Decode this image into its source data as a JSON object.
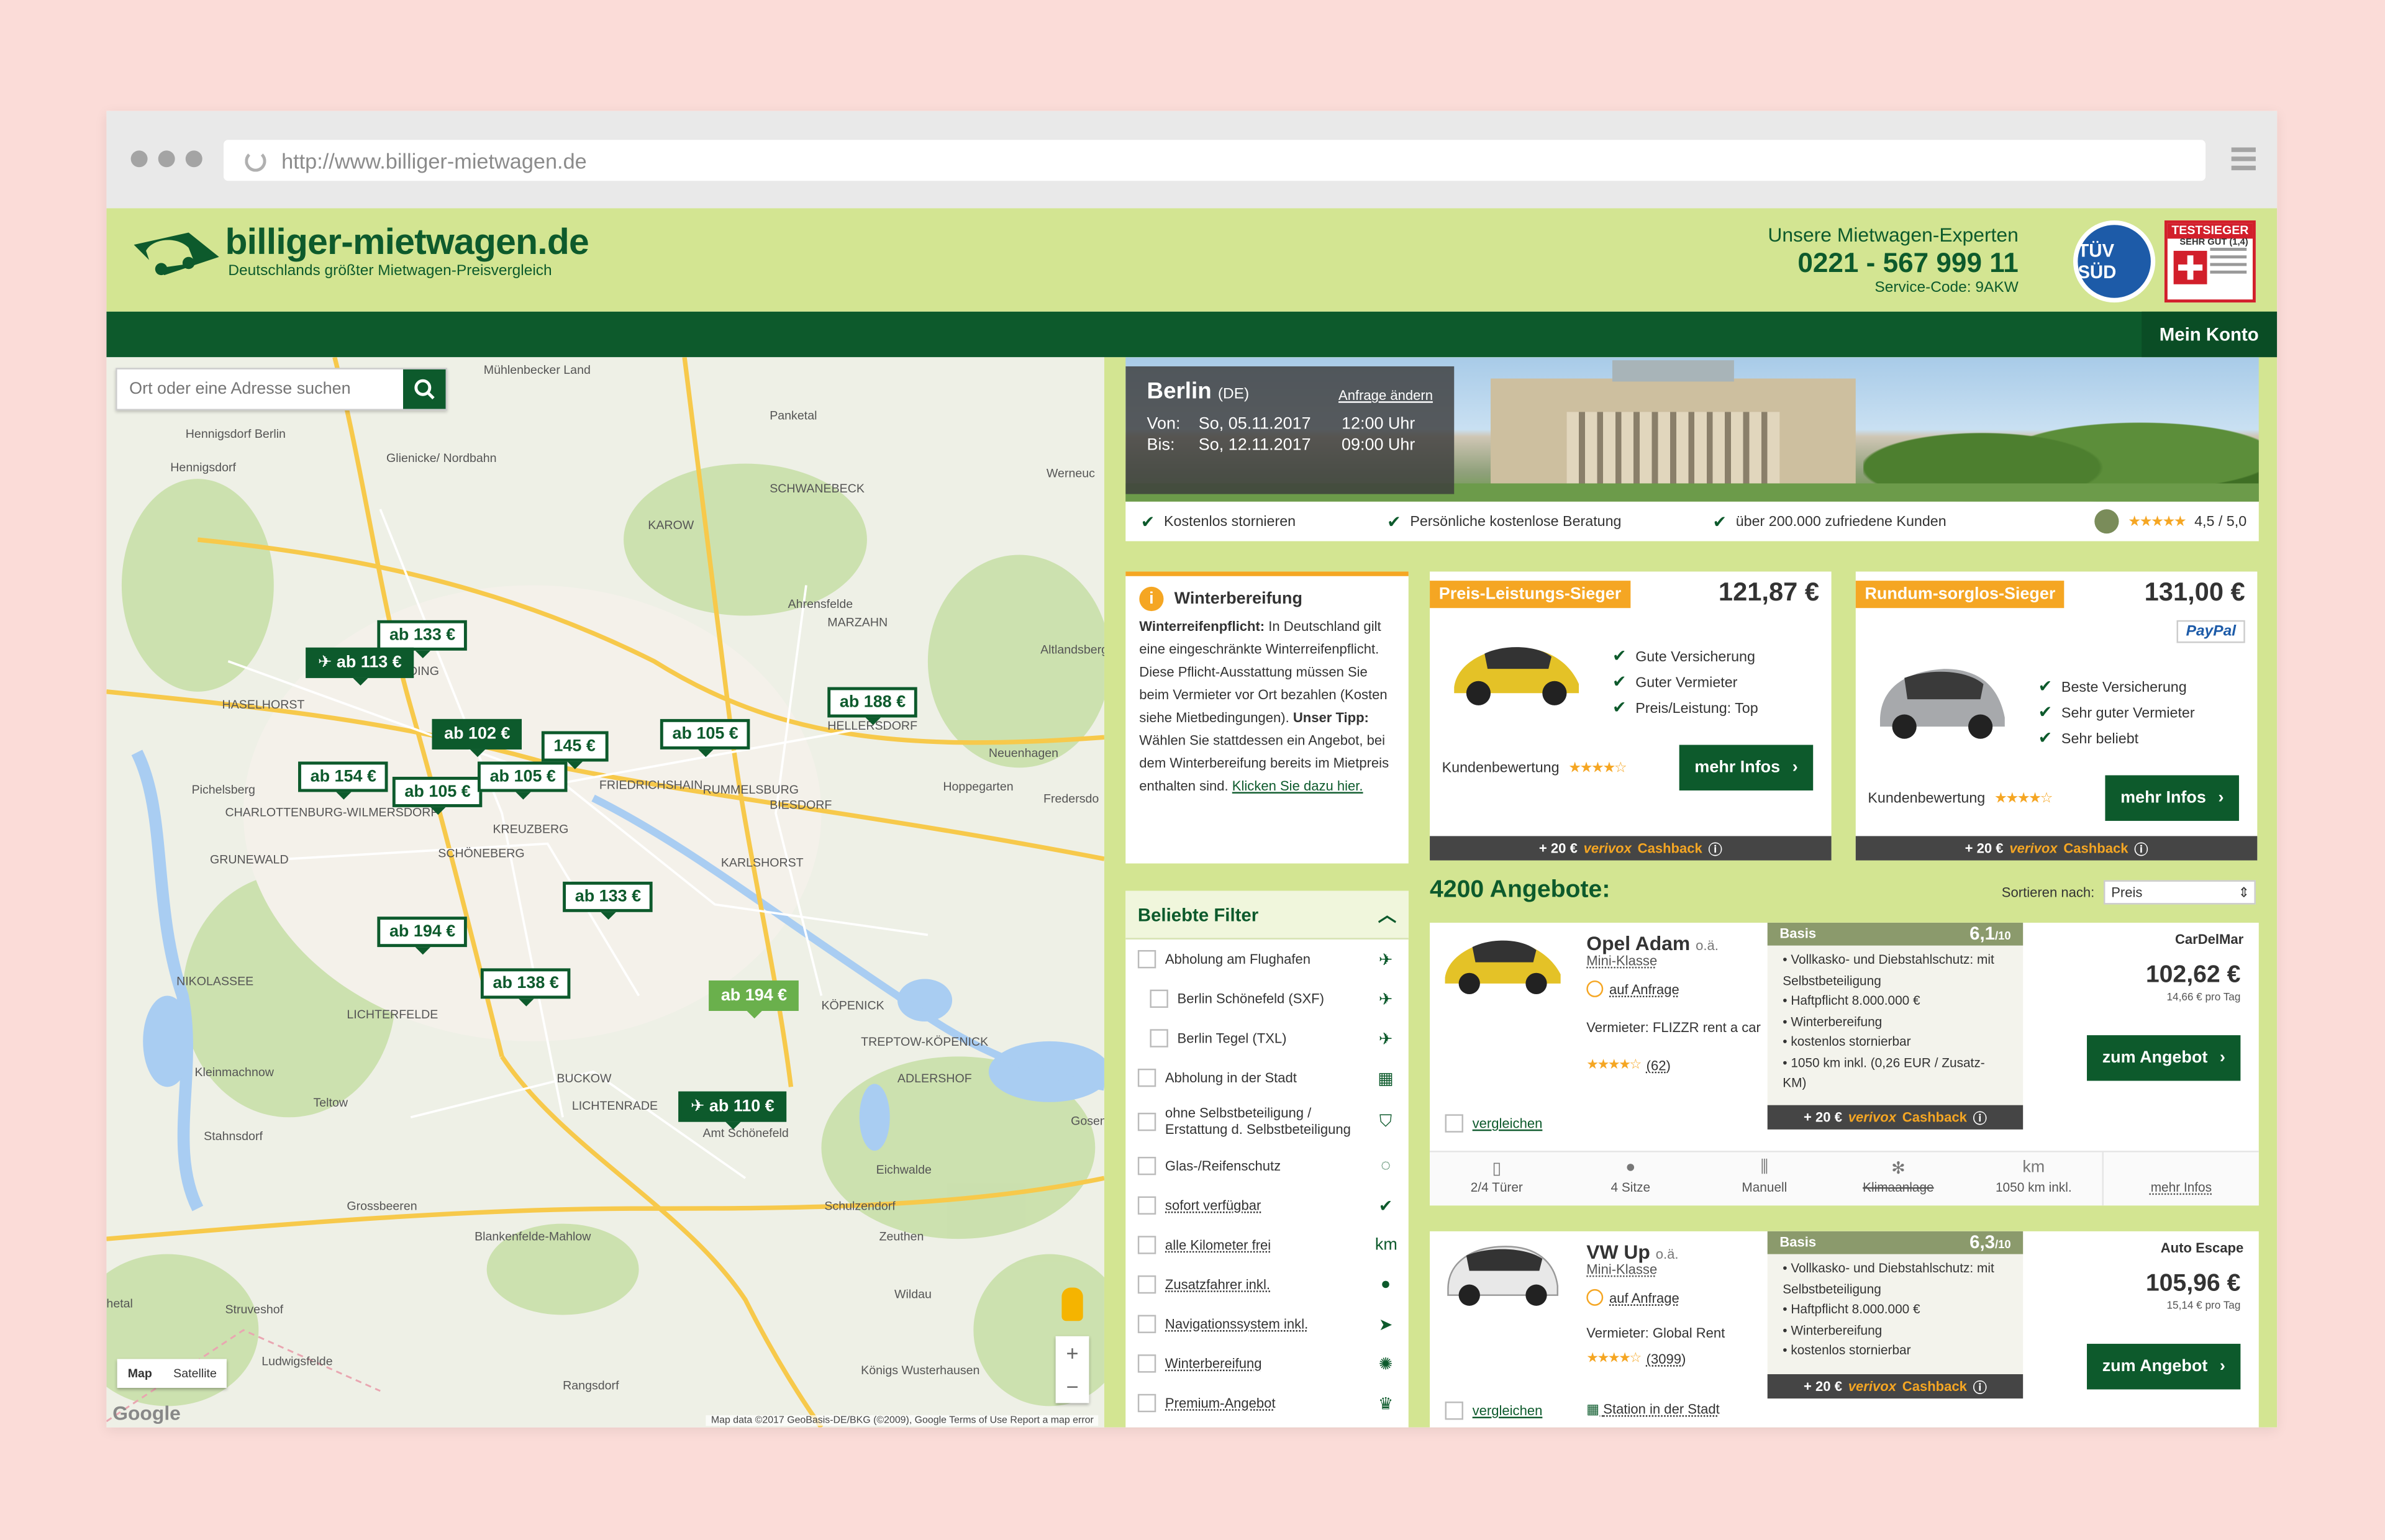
{
  "browser": {
    "url": "http://www.billiger-mietwagen.de"
  },
  "header": {
    "logo_name": "billiger-mietwagen.de",
    "logo_tagline": "Deutschlands größter Mietwagen-Preisvergleich",
    "experts_label": "Unsere Mietwagen-Experten",
    "phone": "0221 - 567 999 11",
    "service_code": "Service-Code: 9AKW",
    "tuv_label": "TÜV SÜD",
    "testsieger_label": "TESTSIEGER",
    "testsieger_grade": "SEHR GUT (1,4)"
  },
  "nav": {
    "account": "Mein Konto"
  },
  "map": {
    "search_placeholder": "Ort oder eine Adresse suchen",
    "type_map": "Map",
    "type_satellite": "Satellite",
    "zoom_in": "+",
    "zoom_out": "−",
    "footer": "Map data ©2017 GeoBasis-DE/BKG (©2009), Google   Terms of Use   Report a map error",
    "google": "Google",
    "pins": [
      {
        "label": "ab 133 €",
        "style": "white"
      },
      {
        "label": "✈ ab 113 €",
        "style": "dark"
      },
      {
        "label": "ab 188 €",
        "style": "white"
      },
      {
        "label": "ab 102 €",
        "style": "dark"
      },
      {
        "label": "145 €",
        "style": "white"
      },
      {
        "label": "ab 105 €",
        "style": "white"
      },
      {
        "label": "ab 154 €",
        "style": "white"
      },
      {
        "label": "ab 105 €",
        "style": "white"
      },
      {
        "label": "ab 105 €",
        "style": "white"
      },
      {
        "label": "ab 133 €",
        "style": "white"
      },
      {
        "label": "ab 194 €",
        "style": "white"
      },
      {
        "label": "ab 138 €",
        "style": "white"
      },
      {
        "label": "ab 194 €",
        "style": "light"
      },
      {
        "label": "✈ ab 110 €",
        "style": "dark"
      }
    ],
    "places": [
      "Mühlenbecker Land",
      "Hennigsdorf Berlin",
      "Hennigsdorf",
      "Glienicke/ Nordbahn",
      "Panketal",
      "SCHWANEBECK",
      "KAROW",
      "Werneuc",
      "Ahrensfelde",
      "Altlandsberg",
      "WEDDING",
      "HASELHORST",
      "Neuenhagen",
      "Hoppegarten",
      "Fredersdo",
      "Pichelsberg",
      "CHARLOTTENBURG-WILMERSDORF",
      "FRIEDRICHSHAIN",
      "KREUZBERG",
      "KARLSHORST",
      "SCHÖNEBERG",
      "GRUNEWALD",
      "NIKOLASSEE",
      "LICHTERFELDE",
      "KÖPENICK",
      "TREPTOW-KÖPENICK",
      "Kleinmachnow",
      "Teltow",
      "Stahnsdorf",
      "Amt Schönefeld",
      "Eichwalde",
      "Gosen",
      "Grossbeeren",
      "Blankenfelde-Mahlow",
      "Schulzendorf",
      "Zeuthen",
      "Wildau",
      "Struveshof",
      "Ludwigsfelde",
      "Rangsdorf",
      "Königs Wusterhausen",
      "hetal",
      "MARZAHN",
      "HELLERSDORF",
      "RUMMELSBURG",
      "BIESDORF",
      "LICHTENRADE",
      "BUCKOW",
      "ADLERSHOF"
    ]
  },
  "hero": {
    "city": "Berlin",
    "country": "(DE)",
    "change_link": "Anfrage ändern",
    "from_label": "Von:",
    "from_date": "So, 05.11.2017",
    "from_time": "12:00 Uhr",
    "to_label": "Bis:",
    "to_date": "So, 12.11.2017",
    "to_time": "09:00 Uhr"
  },
  "usp": {
    "items": [
      "Kostenlos stornieren",
      "Persönliche kostenlose Beratung",
      "über 200.000 zufriedene Kunden"
    ],
    "rating": "4,5 / 5,0"
  },
  "winter": {
    "title": "Winterbereifung",
    "bold1": "Winterreifenpflicht:",
    "text1": " In Deutschland gilt eine eingeschränkte Winterreifenpflicht. Diese Pflicht-Ausstattung müssen Sie beim Vermieter vor Ort bezahlen (Kosten siehe Mietbedingungen). ",
    "bold2": "Unser Tipp:",
    "text2": " Wählen Sie stattdessen ein Angebot, bei dem Winterbereifung bereits im Mietpreis enthalten sind. ",
    "link": "Klicken Sie dazu hier."
  },
  "filter": {
    "title": "Beliebte Filter",
    "items": [
      {
        "label": "Abholung am Flughafen",
        "icon": "✈",
        "sub": false
      },
      {
        "label": "Berlin Schönefeld (SXF)",
        "icon": "✈",
        "sub": true
      },
      {
        "label": "Berlin Tegel (TXL)",
        "icon": "✈",
        "sub": true
      },
      {
        "label": "Abholung in der Stadt",
        "icon": "▦",
        "sub": false
      },
      {
        "label": "ohne Selbstbeteiligung / Erstattung d. Selbstbeteiligung",
        "icon": "⛉",
        "sub": false
      },
      {
        "label": "Glas-/Reifenschutz",
        "icon": "◌",
        "sub": false
      },
      {
        "label": "sofort verfügbar",
        "icon": "✔",
        "sub": false
      },
      {
        "label": "alle Kilometer frei",
        "icon": "km",
        "sub": false
      },
      {
        "label": "Zusatzfahrer inkl.",
        "icon": "●",
        "sub": false
      },
      {
        "label": "Navigationssystem inkl.",
        "icon": "➤",
        "sub": false
      },
      {
        "label": "Winterbereifung",
        "icon": "✺",
        "sub": false
      },
      {
        "label": "Premium-Angebot",
        "icon": "♛",
        "sub": false
      }
    ]
  },
  "winners": [
    {
      "badge": "Preis-Leistungs-Sieger",
      "price": "121,87 €",
      "features": [
        "Gute Versicherung",
        "Guter Vermieter",
        "Preis/Leistung: Top"
      ],
      "rating_label": "Kundenbewertung",
      "button": "mehr Infos",
      "cashback_amount": "+ 20 €",
      "cashback_brand": "verivox",
      "cashback_label": "Cashback"
    },
    {
      "badge": "Rundum-sorglos-Sieger",
      "price": "131,00 €",
      "paypal": "PayPal",
      "features": [
        "Beste Versicherung",
        "Sehr guter Vermieter",
        "Sehr beliebt"
      ],
      "rating_label": "Kundenbewertung",
      "button": "mehr Infos",
      "cashback_amount": "+ 20 €",
      "cashback_brand": "verivox",
      "cashback_label": "Cashback"
    }
  ],
  "offers_header": {
    "title": "4200 Angebote:",
    "sort_label": "Sortieren nach:",
    "sort_value": "Preis"
  },
  "offers": [
    {
      "model": "Opel Adam",
      "oae": "o.ä.",
      "class": "Mini-Klasse",
      "availability": "auf Anfrage",
      "vendor_label": "Vermieter:",
      "vendor_name": "FLIZZR rent a car",
      "reviews": "(62)",
      "compare": "vergleichen",
      "basis_label": "Basis",
      "score": "6,1",
      "score_max": "/10",
      "basis_items": [
        "Vollkasko- und Diebstahlschutz: mit Selbstbeteiligung",
        "Haftpflicht 8.000.000 €",
        "Winterbereifung",
        "kostenlos stornierbar",
        "1050 km inkl. (0,26 EUR / Zusatz-KM)"
      ],
      "cashback_amount": "+ 20 €",
      "cashback_brand": "verivox",
      "cashback_label": "Cashback",
      "supplier": "CarDelMar",
      "price": "102,62 €",
      "per_day": "14,66 € pro Tag",
      "button": "zum Angebot",
      "features": [
        "2/4 Türer",
        "4 Sitze",
        "Manuell",
        "Klimaanlage",
        "1050 km inkl."
      ],
      "more": "mehr Infos"
    },
    {
      "model": "VW Up",
      "oae": "o.ä.",
      "class": "Mini-Klasse",
      "availability": "auf Anfrage",
      "vendor_label": "Vermieter:",
      "vendor_name": "Global Rent",
      "reviews": "(3099)",
      "compare": "vergleichen",
      "station": "Station in der Stadt",
      "basis_label": "Basis",
      "score": "6,3",
      "score_max": "/10",
      "basis_items": [
        "Vollkasko- und Diebstahlschutz: mit Selbstbeteiligung",
        "Haftpflicht 8.000.000 €",
        "Winterbereifung",
        "kostenlos stornierbar"
      ],
      "cashback_amount": "+ 20 €",
      "cashback_brand": "verivox",
      "cashback_label": "Cashback",
      "supplier": "Auto Escape",
      "price": "105,96 €",
      "per_day": "15,14 € pro Tag",
      "button": "zum Angebot"
    }
  ],
  "colors": {
    "brand_green": "#0d5a2c",
    "light_green": "#d3e592",
    "accent_orange": "#f5a623",
    "page_bg": "#fbdcd8"
  }
}
